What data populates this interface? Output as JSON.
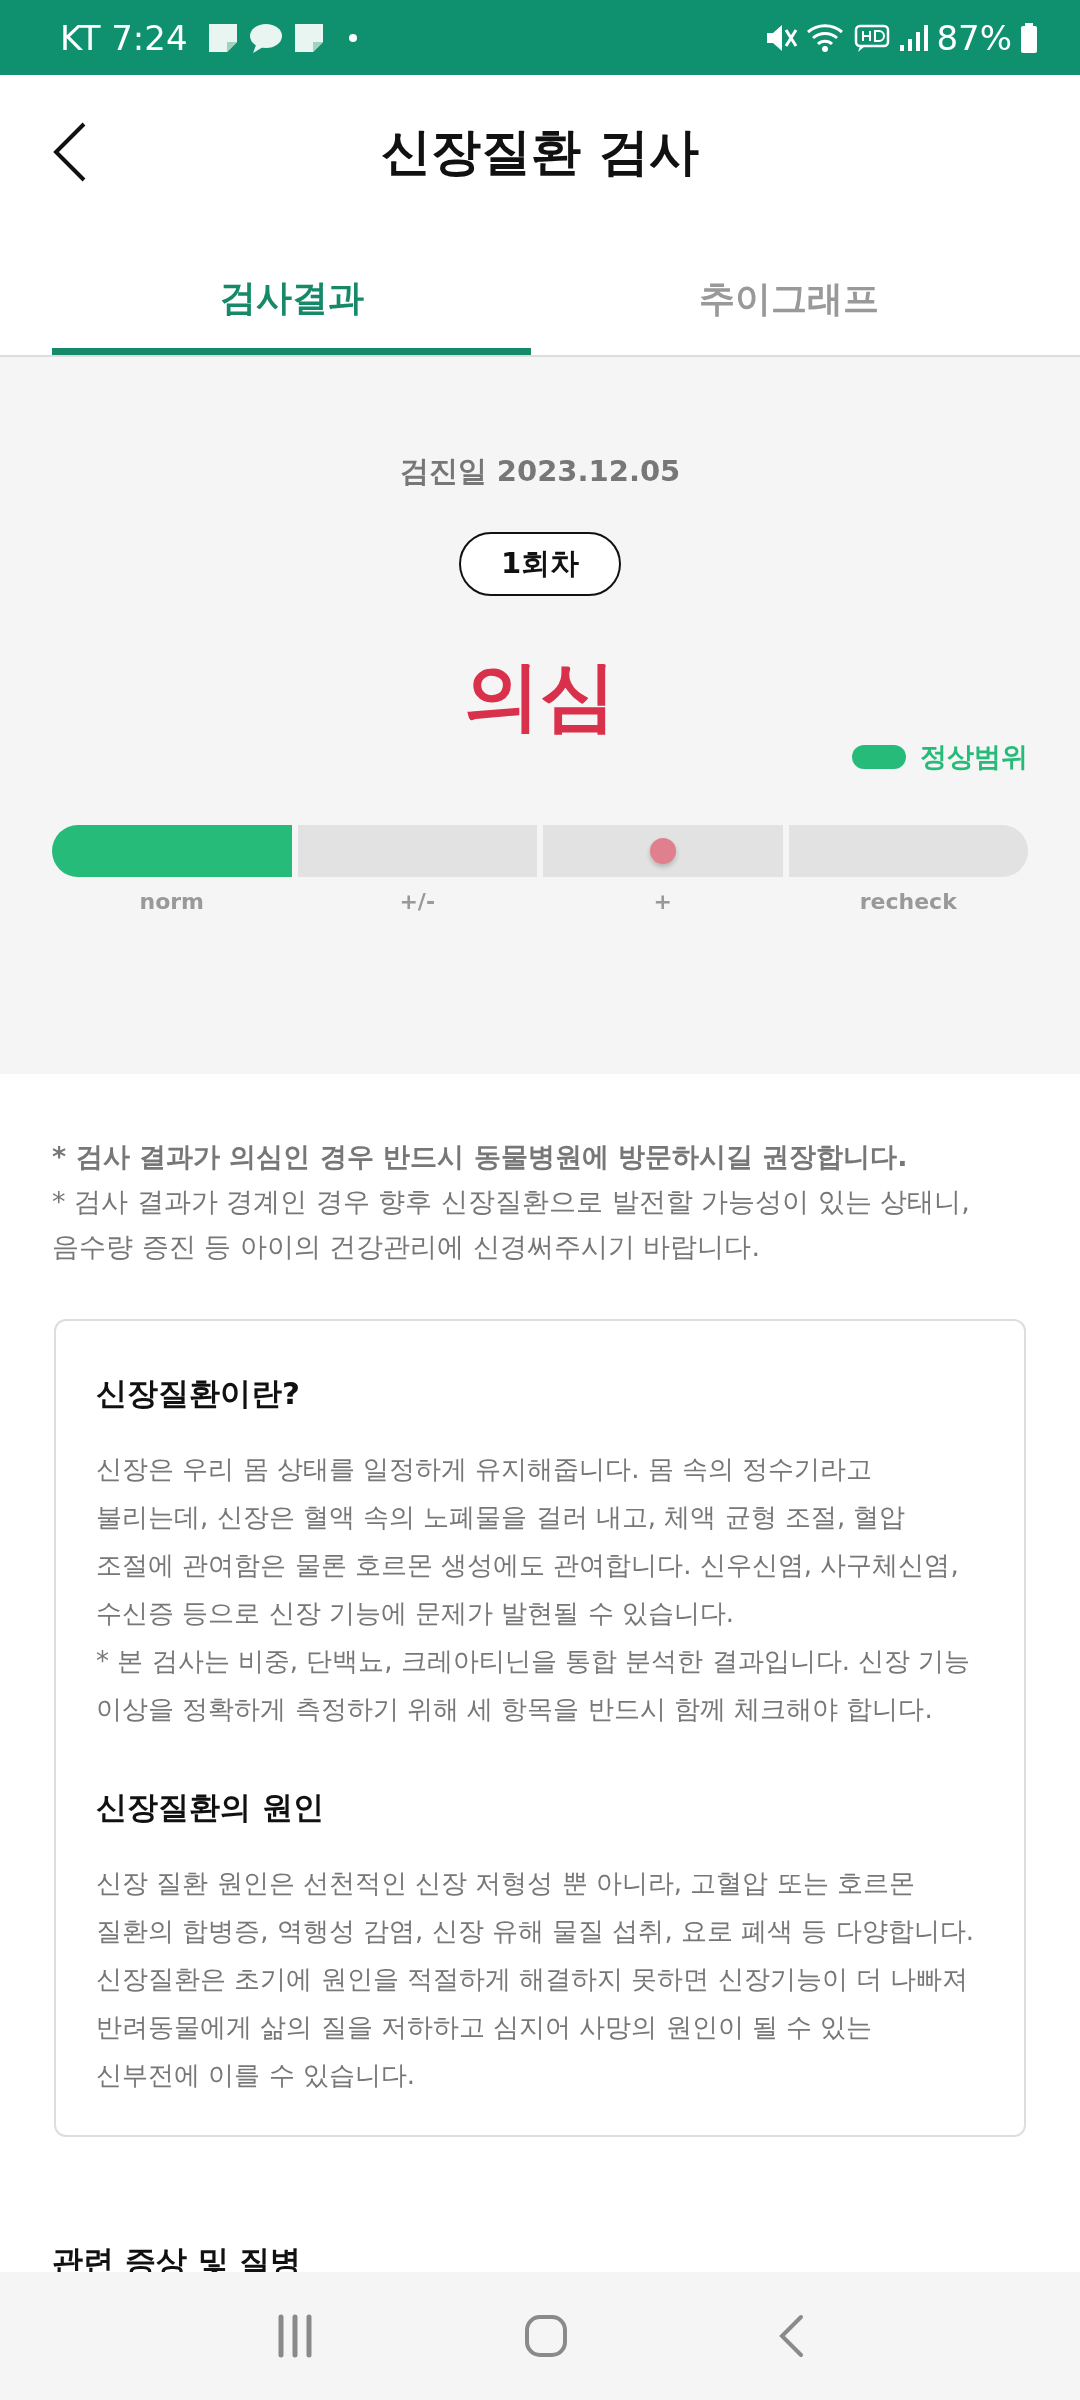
{
  "status_bar": {
    "carrier_time": "KT 7:24",
    "battery": "87%"
  },
  "header": {
    "title": "신장질환 검사"
  },
  "tabs": [
    {
      "label": "검사결과",
      "selected": true
    },
    {
      "label": "추이그래프",
      "selected": false
    }
  ],
  "result": {
    "date": "검진일 2023.12.05",
    "round": "1회차",
    "verdict": "의심",
    "legend": "정상범위",
    "segments": [
      {
        "label": "norm",
        "normal": true,
        "marker": false
      },
      {
        "label": "+/-",
        "normal": false,
        "marker": false
      },
      {
        "label": "+",
        "normal": false,
        "marker": true
      },
      {
        "label": "recheck",
        "normal": false,
        "marker": false
      }
    ]
  },
  "notes": [
    {
      "text": "* 검사 결과가 의심인 경우 반드시 동물병원에 방문하시길 권장합니다.",
      "emphasis": true
    },
    {
      "text": "* 검사 결과가 경계인 경우 향후 신장질환으로 발전할 가능성이 있는 상태니,\n음수량 증진 등 아이의 건강관리에 신경써주시기 바랍니다.",
      "emphasis": false
    }
  ],
  "info_card": [
    {
      "heading": "신장질환이란?",
      "body": "신장은 우리 몸 상태를 일정하게 유지해줍니다. 몸 속의 정수기라고\n불리는데, 신장은 혈액 속의 노폐물을 걸러 내고, 체액 균형 조절, 혈압\n조절에 관여함은 물론 호르몬 생성에도 관여합니다. 신우신염, 사구체신염,\n수신증 등으로 신장 기능에 문제가 발현될 수 있습니다.\n* 본 검사는 비중, 단백뇨, 크레아티닌을 통합 분석한 결과입니다. 신장 기능\n이상을 정확하게 측정하기 위해 세 항목을 반드시 함께 체크해야 합니다."
    },
    {
      "heading": "신장질환의 원인",
      "body": "신장 질환 원인은 선천적인 신장 저형성 뿐 아니라, 고혈압 또는 호르몬\n질환의 합병증, 역행성 감염, 신장 유해 물질 섭취, 요로 폐색 등 다양합니다.\n신장질환은 초기에 원인을 적절하게 해결하지 못하면 신장기능이 더 나빠져\n반려동물에게 삶의 질을 저하하고 심지어 사망의 원인이 될 수 있는\n신부전에 이를 수 있습니다."
    }
  ],
  "next_section": {
    "heading": "관련 증상 및 질병"
  }
}
